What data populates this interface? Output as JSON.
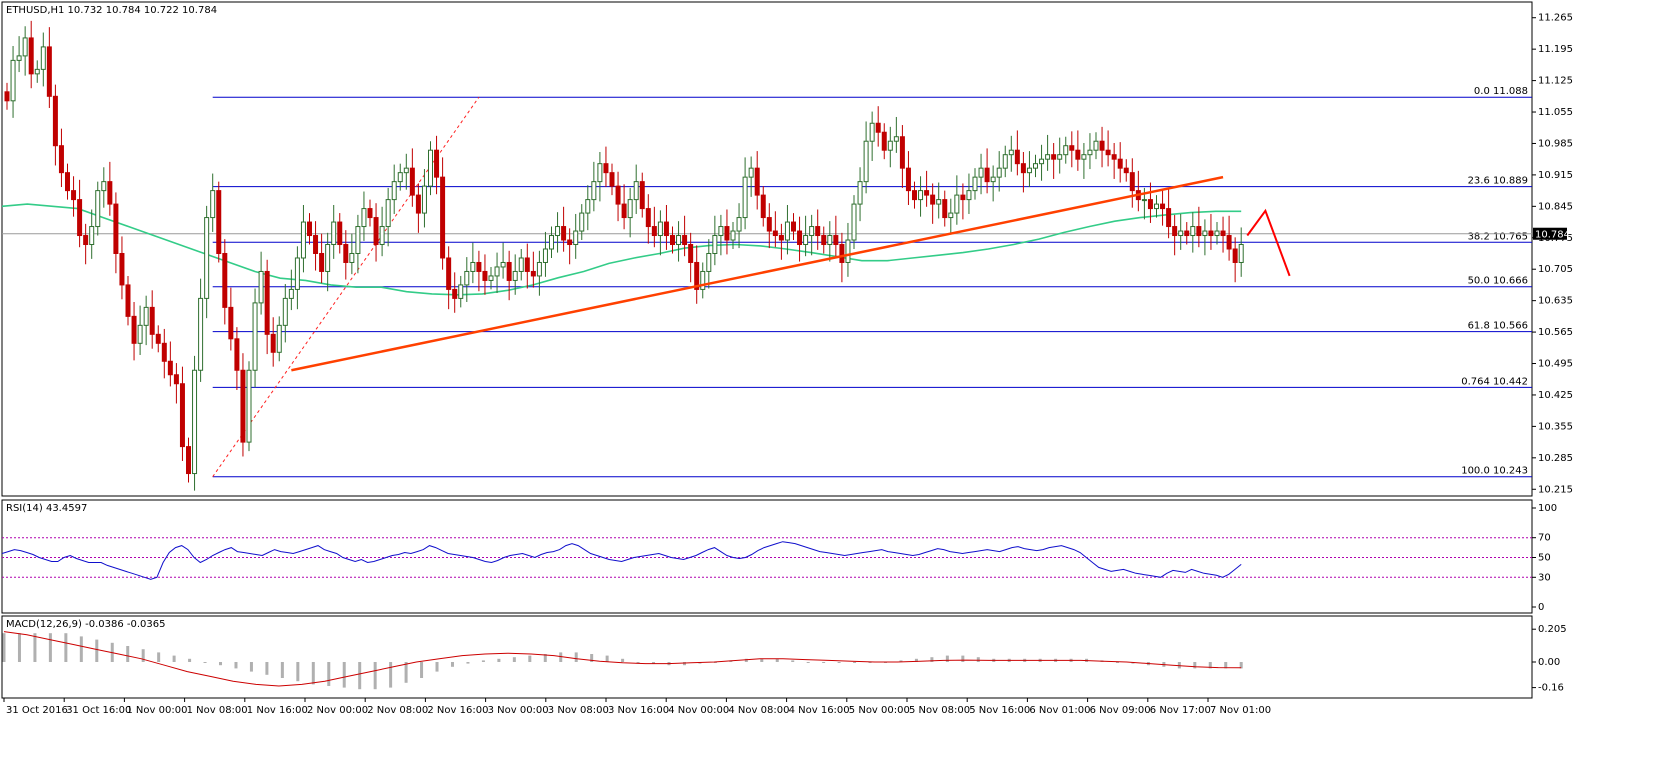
{
  "header": {
    "main": "ETHUSD,H1  10.732 10.784 10.722 10.784",
    "rsi": "RSI(14) 43.4597",
    "macd": "MACD(12,26,9) -0.0386 -0.0365"
  },
  "colors": {
    "bull": "#2f6f2f",
    "bull_fill": "#ffffff",
    "bear": "#c00000",
    "ma": "#33cc88",
    "trend": "#ff4000",
    "fib": "#0000cc",
    "rsi_line": "#1010cc",
    "rsi_level": "#b000b0",
    "macd_hist": "#b0b0b0",
    "macd_signal": "#cc0000",
    "price_line": "#9a9a9a",
    "grid": "#000000"
  },
  "chart_data": [
    {
      "type": "candlestick",
      "symbol": "ETHUSD",
      "timeframe": "H1",
      "ylim": [
        10.2,
        11.3
      ],
      "y_ticks": [
        "11.265",
        "11.195",
        "11.125",
        "11.055",
        "10.985",
        "10.915",
        "10.845",
        "10.775",
        "10.705",
        "10.635",
        "10.565",
        "10.495",
        "10.425",
        "10.355",
        "10.285",
        "10.215"
      ],
      "x_ticks": [
        "31 Oct 2016",
        "31 Oct 16:00",
        "1 Nov 00:00",
        "1 Nov 08:00",
        "1 Nov 16:00",
        "2 Nov 00:00",
        "2 Nov 08:00",
        "2 Nov 16:00",
        "3 Nov 00:00",
        "3 Nov 08:00",
        "3 Nov 16:00",
        "4 Nov 00:00",
        "4 Nov 08:00",
        "4 Nov 16:00",
        "5 Nov 00:00",
        "5 Nov 08:00",
        "5 Nov 16:00",
        "6 Nov 01:00",
        "6 Nov 09:00",
        "6 Nov 17:00",
        "7 Nov 01:00"
      ],
      "current_price": "10.784",
      "fib_levels": [
        {
          "label": "0.0",
          "value": "11.088",
          "v": 11.088
        },
        {
          "label": "23.6",
          "value": "10.889",
          "v": 10.889
        },
        {
          "label": "38.2",
          "value": "10.765",
          "v": 10.765
        },
        {
          "label": "50.0",
          "value": "10.666",
          "v": 10.666
        },
        {
          "label": "61.8",
          "value": "10.566",
          "v": 10.566
        },
        {
          "label": "0.764",
          "value": "10.442",
          "v": 10.442
        },
        {
          "label": "100.0",
          "value": "10.243",
          "v": 10.243
        }
      ],
      "trendline": {
        "from": [
          47,
          10.48
        ],
        "to": [
          201,
          10.91
        ]
      },
      "fib_diagonal": {
        "from": [
          34,
          10.243
        ],
        "to": [
          78,
          11.088
        ]
      },
      "projection": {
        "points": [
          [
            205,
            10.78
          ],
          [
            208,
            10.835
          ],
          [
            212,
            10.69
          ]
        ]
      },
      "closes": [
        11.08,
        11.17,
        11.18,
        11.22,
        11.14,
        11.15,
        11.2,
        11.09,
        10.98,
        10.92,
        10.88,
        10.86,
        10.78,
        10.76,
        10.8,
        10.88,
        10.9,
        10.85,
        10.74,
        10.67,
        10.6,
        10.54,
        10.58,
        10.62,
        10.56,
        10.54,
        10.5,
        10.47,
        10.45,
        10.31,
        10.25,
        10.48,
        10.64,
        10.82,
        10.88,
        10.74,
        10.62,
        10.55,
        10.48,
        10.32,
        10.48,
        10.63,
        10.7,
        10.56,
        10.52,
        10.58,
        10.64,
        10.66,
        10.73,
        10.81,
        10.78,
        10.74,
        10.7,
        10.76,
        10.81,
        10.76,
        10.72,
        10.74,
        10.8,
        10.84,
        10.82,
        10.76,
        10.8,
        10.86,
        10.9,
        10.92,
        10.93,
        10.87,
        10.83,
        10.89,
        10.97,
        10.91,
        10.73,
        10.66,
        10.64,
        10.67,
        10.7,
        10.72,
        10.7,
        10.68,
        10.69,
        10.71,
        10.72,
        10.68,
        10.7,
        10.73,
        10.7,
        10.69,
        10.72,
        10.75,
        10.78,
        10.8,
        10.77,
        10.76,
        10.79,
        10.83,
        10.86,
        10.9,
        10.94,
        10.92,
        10.89,
        10.85,
        10.82,
        10.86,
        10.9,
        10.84,
        10.8,
        10.78,
        10.81,
        10.78,
        10.76,
        10.78,
        10.76,
        10.72,
        10.66,
        10.7,
        10.74,
        10.78,
        10.8,
        10.77,
        10.79,
        10.82,
        10.91,
        10.93,
        10.87,
        10.82,
        10.79,
        10.78,
        10.77,
        10.81,
        10.79,
        10.76,
        10.78,
        10.8,
        10.78,
        10.76,
        10.78,
        10.76,
        10.72,
        10.77,
        10.85,
        10.9,
        10.99,
        11.03,
        11.01,
        10.97,
        10.99,
        11.0,
        10.93,
        10.88,
        10.86,
        10.88,
        10.87,
        10.85,
        10.86,
        10.82,
        10.83,
        10.87,
        10.86,
        10.88,
        10.91,
        10.93,
        10.9,
        10.91,
        10.93,
        10.96,
        10.97,
        10.94,
        10.92,
        10.93,
        10.94,
        10.95,
        10.96,
        10.95,
        10.96,
        10.98,
        10.97,
        10.95,
        10.96,
        10.97,
        10.99,
        10.97,
        10.96,
        10.95,
        10.93,
        10.92,
        10.88,
        10.86,
        10.86,
        10.84,
        10.85,
        10.84,
        10.8,
        10.78,
        10.79,
        10.78,
        10.8,
        10.78,
        10.79,
        10.78,
        10.79,
        10.78,
        10.75,
        10.72,
        10.76
      ],
      "ma_line": [
        10.845,
        10.85,
        10.845,
        10.84,
        10.82,
        10.8,
        10.78,
        10.76,
        10.74,
        10.72,
        10.7,
        10.685,
        10.68,
        10.67,
        10.665,
        10.665,
        10.655,
        10.65,
        10.648,
        10.65,
        10.658,
        10.67,
        10.686,
        10.7,
        10.718,
        10.73,
        10.74,
        10.752,
        10.758,
        10.76,
        10.757,
        10.75,
        10.742,
        10.733,
        10.724,
        10.724,
        10.73,
        10.736,
        10.742,
        10.75,
        10.76,
        10.772,
        10.787,
        10.8,
        10.812,
        10.82,
        10.826,
        10.831,
        10.834,
        10.834
      ],
      "series": []
    },
    {
      "type": "line",
      "name": "RSI(14)",
      "value": "43.4597",
      "ylim": [
        0,
        100
      ],
      "y_ticks": [
        "100",
        "70",
        "50",
        "30",
        "0"
      ],
      "levels": [
        70,
        50,
        30
      ],
      "values": [
        54,
        56,
        58,
        57,
        55,
        53,
        50,
        48,
        46,
        46,
        50,
        52,
        49,
        47,
        45,
        45,
        45,
        42,
        40,
        38,
        36,
        34,
        32,
        30,
        28,
        30,
        45,
        55,
        60,
        62,
        58,
        50,
        45,
        48,
        52,
        55,
        58,
        60,
        56,
        55,
        54,
        53,
        52,
        55,
        58,
        56,
        55,
        54,
        56,
        58,
        60,
        62,
        58,
        56,
        54,
        50,
        48,
        46,
        48,
        45,
        46,
        48,
        50,
        52,
        53,
        55,
        54,
        56,
        58,
        62,
        60,
        57,
        54,
        53,
        52,
        51,
        50,
        48,
        46,
        45,
        47,
        50,
        52,
        53,
        54,
        52,
        50,
        53,
        55,
        56,
        58,
        62,
        64,
        62,
        58,
        54,
        52,
        50,
        48,
        47,
        46,
        48,
        50,
        51,
        52,
        53,
        54,
        52,
        50,
        49,
        48,
        50,
        52,
        55,
        58,
        60,
        56,
        52,
        50,
        49,
        50,
        53,
        57,
        60,
        62,
        64,
        66,
        65,
        64,
        62,
        60,
        58,
        56,
        55,
        54,
        53,
        52,
        53,
        54,
        55,
        56,
        57,
        58,
        56,
        55,
        54,
        53,
        52,
        53,
        55,
        57,
        59,
        58,
        56,
        55,
        54,
        55,
        56,
        57,
        58,
        57,
        56,
        58,
        60,
        61,
        59,
        58,
        57,
        58,
        60,
        61,
        62,
        60,
        58,
        55,
        50,
        45,
        40,
        38,
        36,
        37,
        38,
        36,
        34,
        33,
        32,
        31,
        30,
        34,
        37,
        36,
        35,
        38,
        36,
        34,
        33,
        32,
        30,
        33,
        38,
        43
      ]
    },
    {
      "type": "bar",
      "name": "MACD(12,26,9)",
      "macd": "-0.0386",
      "signal": "-0.0365",
      "ylim": [
        -0.2,
        0.25
      ],
      "y_ticks": [
        "0.205",
        "0.00",
        "-0.16"
      ],
      "hist": [
        0.18,
        0.18,
        0.18,
        0.18,
        0.18,
        0.16,
        0.14,
        0.12,
        0.1,
        0.08,
        0.06,
        0.04,
        0.02,
        0.0,
        -0.02,
        -0.04,
        -0.06,
        -0.08,
        -0.1,
        -0.12,
        -0.14,
        -0.15,
        -0.16,
        -0.17,
        -0.17,
        -0.16,
        -0.13,
        -0.1,
        -0.06,
        -0.03,
        -0.01,
        0.01,
        0.02,
        0.03,
        0.04,
        0.05,
        0.06,
        0.06,
        0.05,
        0.04,
        0.02,
        0.0,
        -0.01,
        -0.02,
        -0.02,
        -0.01,
        0.0,
        0.01,
        0.02,
        0.02,
        0.02,
        0.01,
        0.0,
        0.0,
        0.0,
        0.0,
        0.0,
        0.0,
        0.01,
        0.02,
        0.03,
        0.04,
        0.04,
        0.03,
        0.02,
        0.02,
        0.02,
        0.02,
        0.02,
        0.02,
        0.02,
        0.01,
        0.0,
        -0.01,
        -0.02,
        -0.03,
        -0.04,
        -0.04,
        -0.04,
        -0.04,
        -0.04
      ],
      "signal_line": [
        0.19,
        0.17,
        0.14,
        0.11,
        0.08,
        0.05,
        0.02,
        -0.02,
        -0.06,
        -0.09,
        -0.12,
        -0.14,
        -0.15,
        -0.14,
        -0.12,
        -0.09,
        -0.06,
        -0.03,
        0.0,
        0.02,
        0.04,
        0.05,
        0.055,
        0.05,
        0.04,
        0.02,
        0.005,
        -0.005,
        -0.01,
        -0.01,
        -0.005,
        0.0,
        0.01,
        0.02,
        0.02,
        0.015,
        0.01,
        0.005,
        0.0,
        0.0,
        0.005,
        0.01,
        0.012,
        0.01,
        0.01,
        0.01,
        0.01,
        0.01,
        0.005,
        0.0,
        -0.01,
        -0.02,
        -0.03,
        -0.035,
        -0.0365
      ]
    }
  ]
}
